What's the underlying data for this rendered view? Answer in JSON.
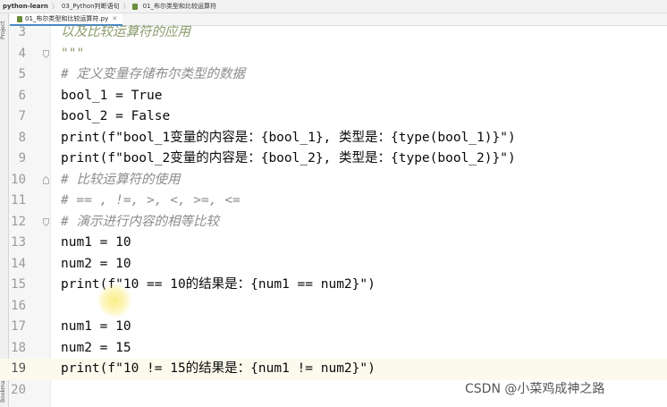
{
  "breadcrumb": {
    "project": "python-learn",
    "folder": "03_Python判断语句",
    "file": "01_布尔类型和比较运算符"
  },
  "tab": {
    "label": "01_布尔类型和比较运算符.py"
  },
  "side_labels": {
    "project": "Project",
    "bookmarks": "Bookmarks"
  },
  "lines": [
    {
      "n": "3",
      "text": "以及比较运算符的应用"
    },
    {
      "n": "4",
      "text": "\"\"\""
    },
    {
      "n": "5",
      "text": "# 定义变量存储布尔类型的数据"
    },
    {
      "n": "6",
      "text": "bool_1 = True"
    },
    {
      "n": "7",
      "text": "bool_2 = False"
    },
    {
      "n": "8",
      "text": "print(f\"bool_1变量的内容是：{bool_1}, 类型是：{type(bool_1)}\")"
    },
    {
      "n": "9",
      "text": "print(f\"bool_2变量的内容是：{bool_2}, 类型是：{type(bool_2)}\")"
    },
    {
      "n": "10",
      "text": "# 比较运算符的使用"
    },
    {
      "n": "11",
      "text": "# == , !=, >, <, >=, <="
    },
    {
      "n": "12",
      "text": "# 演示进行内容的相等比较"
    },
    {
      "n": "13",
      "text": "num1 = 10"
    },
    {
      "n": "14",
      "text": "num2 = 10"
    },
    {
      "n": "15",
      "text": "print(f\"10 == 10的结果是：{num1 == num2}\")"
    },
    {
      "n": "16",
      "text": ""
    },
    {
      "n": "17",
      "text": "num1 = 10"
    },
    {
      "n": "18",
      "text": "num2 = 15"
    },
    {
      "n": "19",
      "text": "print(f\"10 != 15的结果是：{num1 != num2}\")"
    },
    {
      "n": "20",
      "text": ""
    }
  ],
  "watermark": "CSDN @小菜鸡成神之路"
}
